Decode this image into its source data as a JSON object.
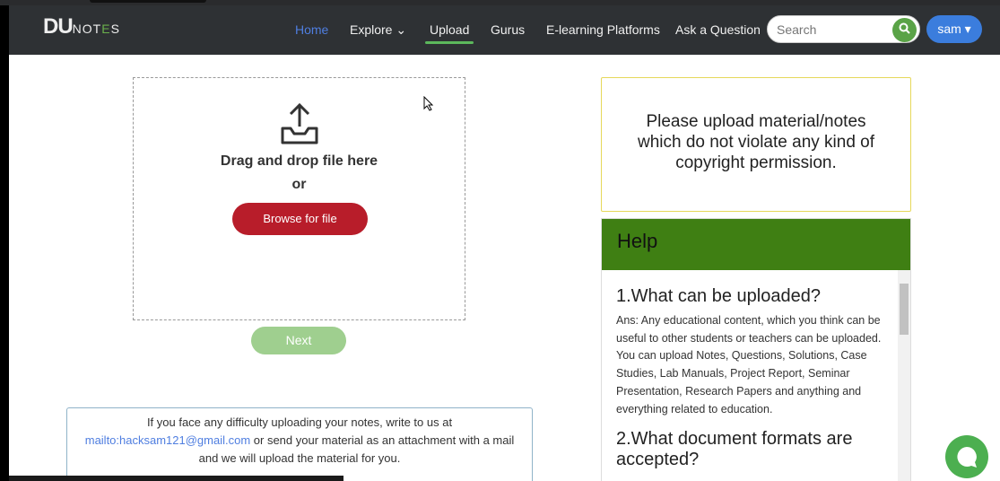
{
  "nav": {
    "logo_main": "DU",
    "logo_sub": "NOTES",
    "items": [
      "Home",
      "Explore",
      "Upload",
      "Gurus",
      "E-learning Platforms",
      "Ask a Question"
    ],
    "search_placeholder": "Search",
    "user": "sam"
  },
  "upload": {
    "drag": "Drag and drop file here",
    "or": "or",
    "browse": "Browse for file",
    "next": "Next"
  },
  "contact": {
    "line1": "If you face any difficulty uploading your notes, write to us at",
    "email": "mailto:hacksam121@gmail.com",
    "line2": " or send your material as an attachment with a mail",
    "line3": "and we will upload the material for you."
  },
  "notice": "Please upload material/notes which do not violate any kind of copyright permission.",
  "help": {
    "title": "Help",
    "q1": "1.What can be uploaded?",
    "a1": "Ans: Any educational content, which you think can be useful to other students or teachers can be uploaded.",
    "a1b": "You can upload Notes, Questions, Solutions, Case Studies, Lab Manuals, Project Report, Seminar Presentation, Research Papers and anything and everything related to education.",
    "q2": "2.What document formats are accepted?"
  },
  "colors": {
    "nav": "#2e3134",
    "accent": "#5aa347",
    "browse": "#b81d2a",
    "help_header": "#3f7f13"
  }
}
